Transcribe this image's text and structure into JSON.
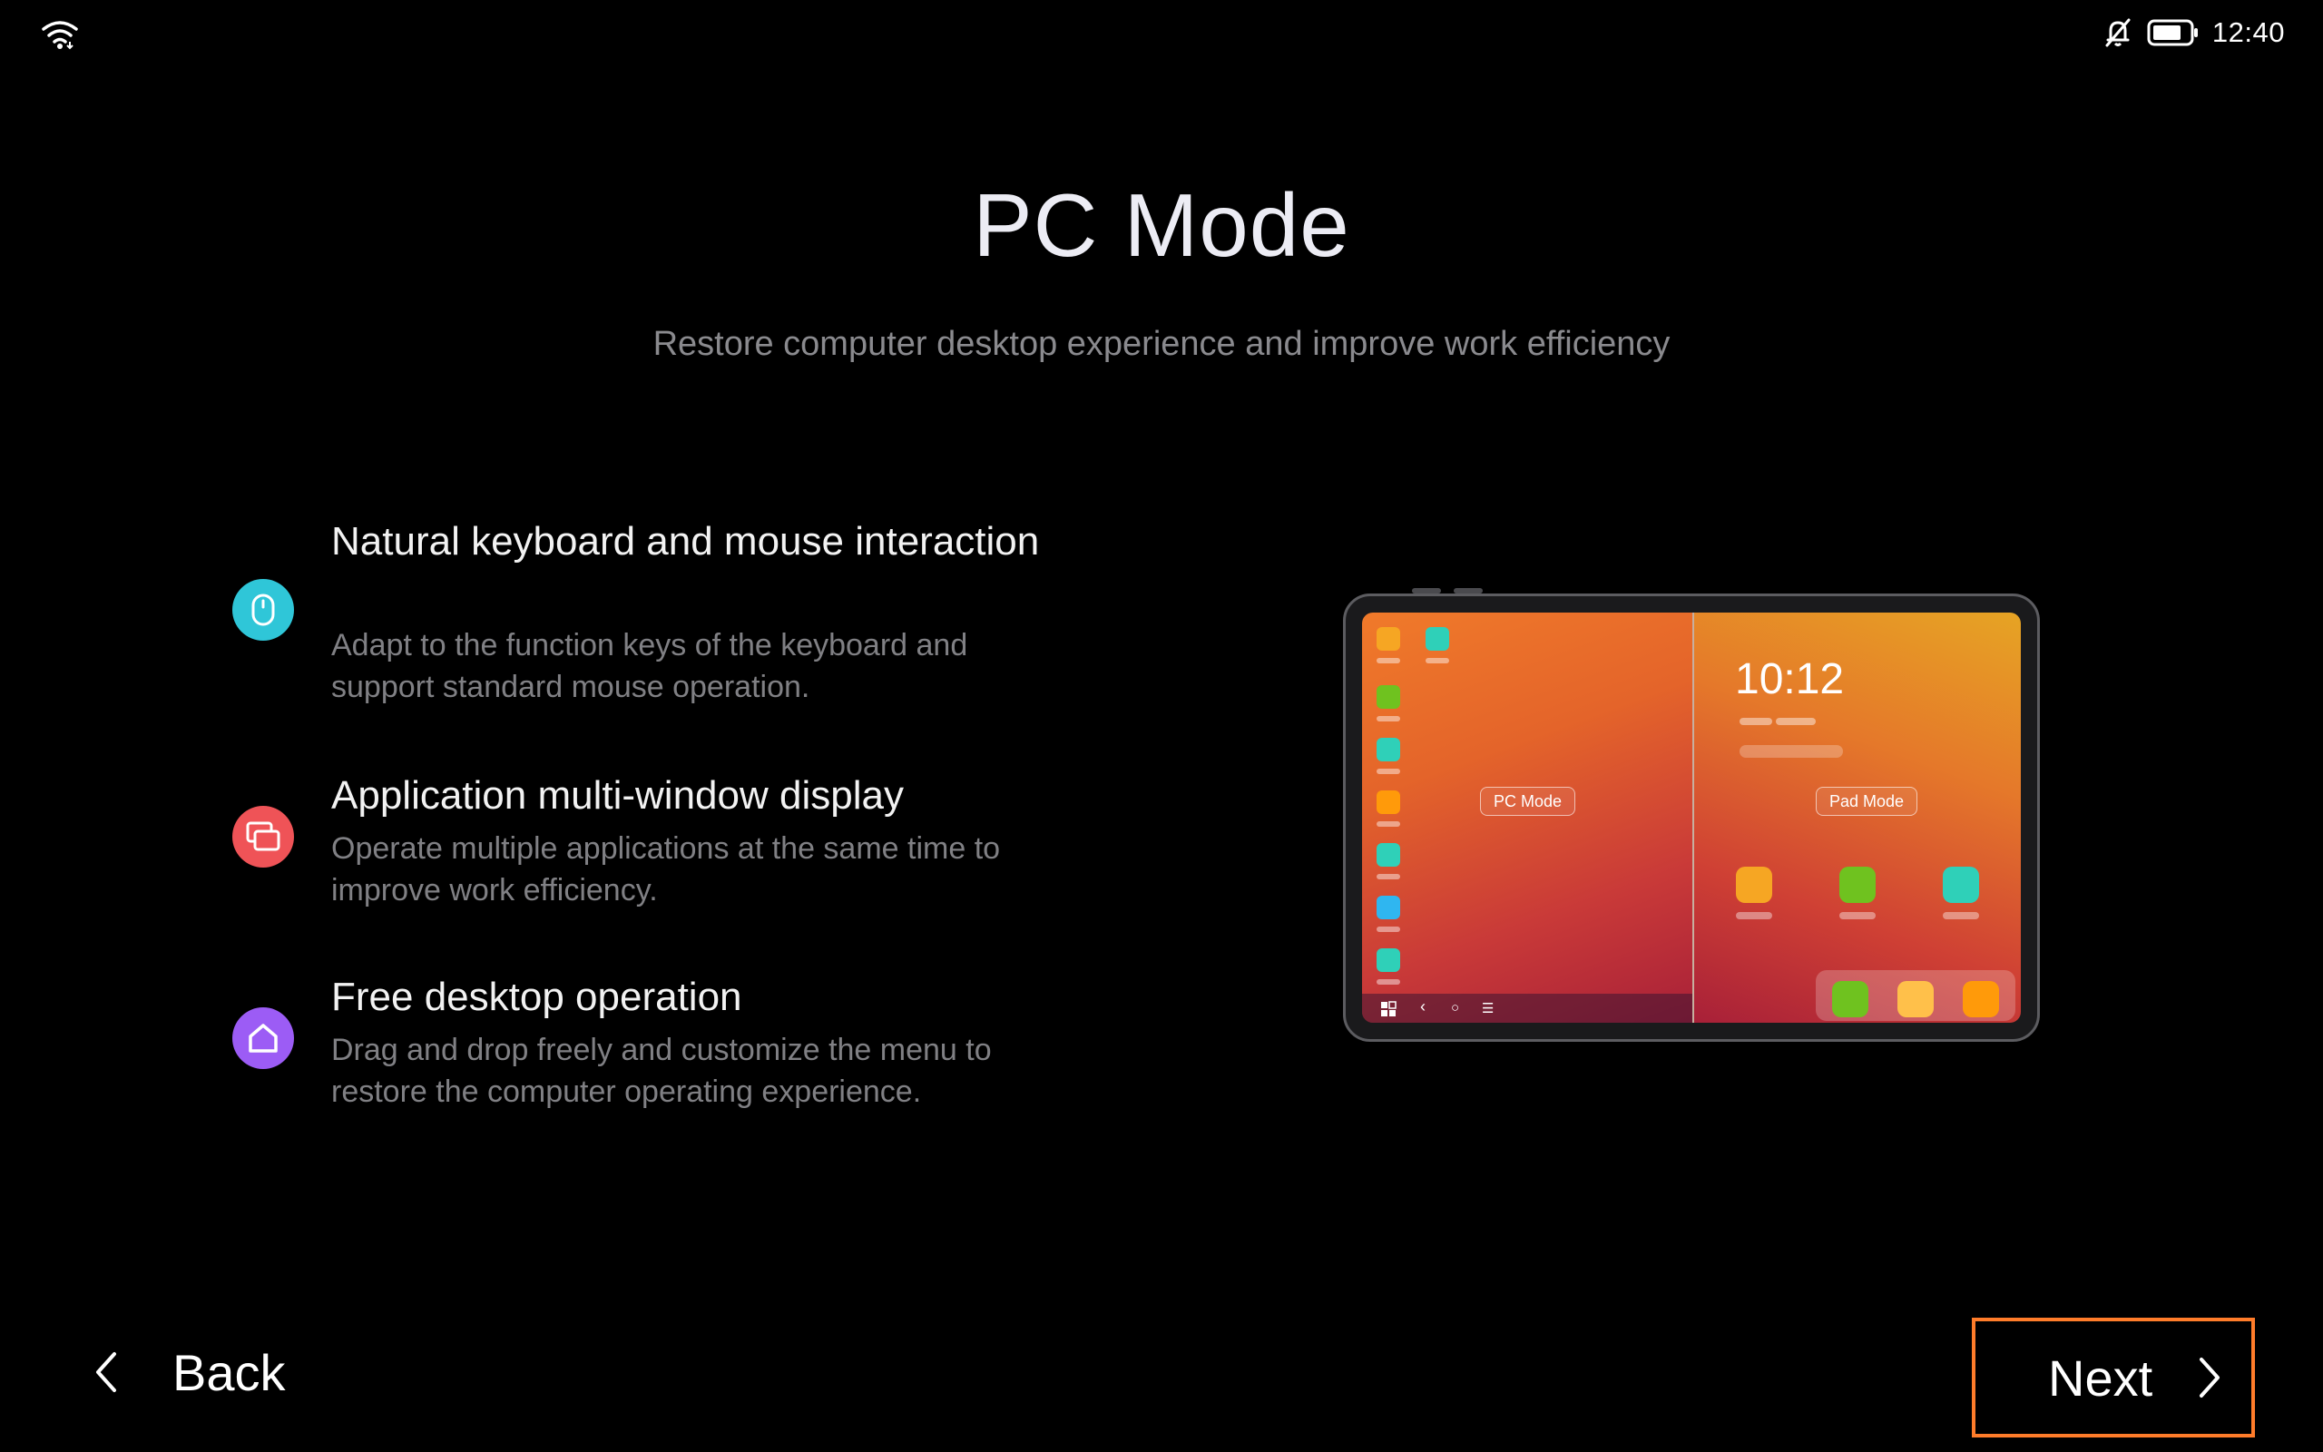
{
  "status_bar": {
    "time": "12:40",
    "icons": [
      "wifi-icon",
      "notifications-off-icon",
      "battery-icon"
    ]
  },
  "header": {
    "title": "PC Mode",
    "subtitle": "Restore computer desktop experience and improve work efficiency"
  },
  "features": [
    {
      "icon": "mouse-icon",
      "color": "#2fc6d8",
      "title": "Natural keyboard and mouse interaction",
      "description": "Adapt to the function keys of the keyboard and support standard mouse operation."
    },
    {
      "icon": "multi-window-icon",
      "color": "#ef5357",
      "title": "Application multi-window display",
      "description": "Operate multiple applications at the same time to improve work efficiency."
    },
    {
      "icon": "home-icon",
      "color": "#9c5cf5",
      "title": "Free desktop operation",
      "description": "Drag and drop freely and customize the menu to restore the computer operating experience."
    }
  ],
  "illustration": {
    "left_label": "PC Mode",
    "right_label": "Pad Mode",
    "pad_time": "10:12",
    "app_colors": [
      "#f6a623",
      "#2fd0b8",
      "#6fc21f",
      "#2fb6f0",
      "#ffc04a",
      "#ff9a0a"
    ]
  },
  "navigation": {
    "back_label": "Back",
    "next_label": "Next",
    "accent": "#ff7c2a"
  }
}
